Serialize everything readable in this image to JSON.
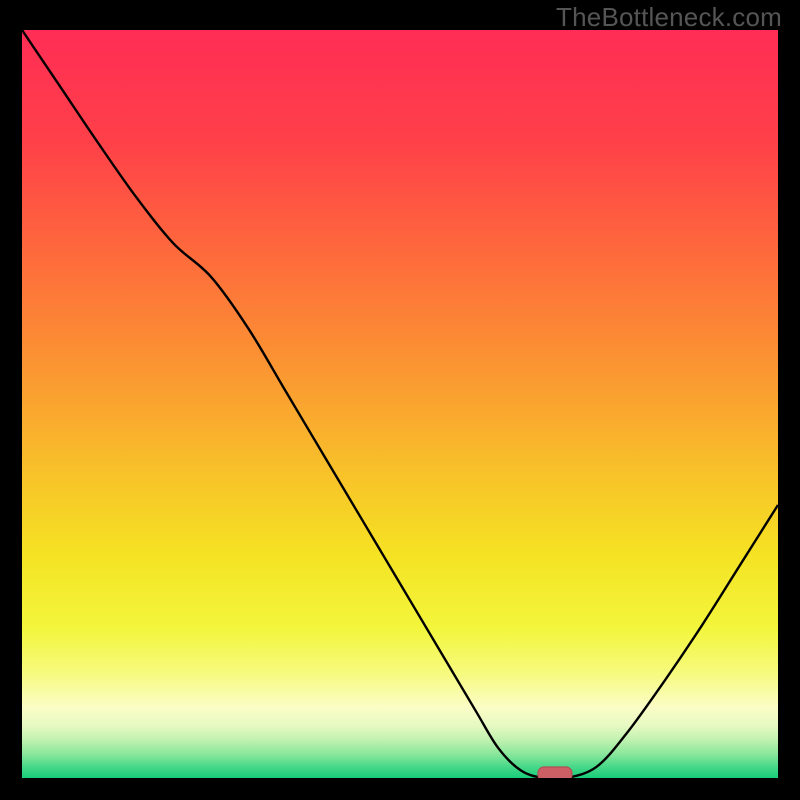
{
  "watermark": "TheBottleneck.com",
  "colors": {
    "frame": "#000000",
    "watermark_text": "#555555",
    "curve": "#000000",
    "marker_fill": "#CC5F66",
    "marker_stroke": "#B24E55",
    "gradient_stops": [
      {
        "offset": 0.0,
        "color": "#FF2D55"
      },
      {
        "offset": 0.15,
        "color": "#FF4049"
      },
      {
        "offset": 0.3,
        "color": "#FE6A3C"
      },
      {
        "offset": 0.45,
        "color": "#FB9532"
      },
      {
        "offset": 0.58,
        "color": "#F8BE2A"
      },
      {
        "offset": 0.7,
        "color": "#F5E223"
      },
      {
        "offset": 0.8,
        "color": "#F3F63C"
      },
      {
        "offset": 0.86,
        "color": "#F6FA7E"
      },
      {
        "offset": 0.905,
        "color": "#FBFDC6"
      },
      {
        "offset": 0.93,
        "color": "#E7F9C2"
      },
      {
        "offset": 0.95,
        "color": "#BEF1AF"
      },
      {
        "offset": 0.968,
        "color": "#8AE79C"
      },
      {
        "offset": 0.984,
        "color": "#4BD98A"
      },
      {
        "offset": 1.0,
        "color": "#18CD7A"
      }
    ]
  },
  "chart_data": {
    "type": "line",
    "title": "",
    "xlabel": "",
    "ylabel": "",
    "xlim": [
      0,
      100
    ],
    "ylim": [
      0,
      100
    ],
    "x": [
      0,
      5,
      10,
      15,
      20,
      25,
      30,
      35,
      40,
      45,
      50,
      55,
      60,
      63,
      66,
      69,
      72,
      76,
      80,
      85,
      90,
      95,
      100
    ],
    "values": [
      100.0,
      92.5,
      85.0,
      77.8,
      71.5,
      67.0,
      60.0,
      51.5,
      43.0,
      34.5,
      26.0,
      17.5,
      9.0,
      4.0,
      1.0,
      0.0,
      0.0,
      1.5,
      6.0,
      13.0,
      20.5,
      28.5,
      36.5
    ],
    "marker": {
      "x": 70.5,
      "y": 0.0
    }
  }
}
